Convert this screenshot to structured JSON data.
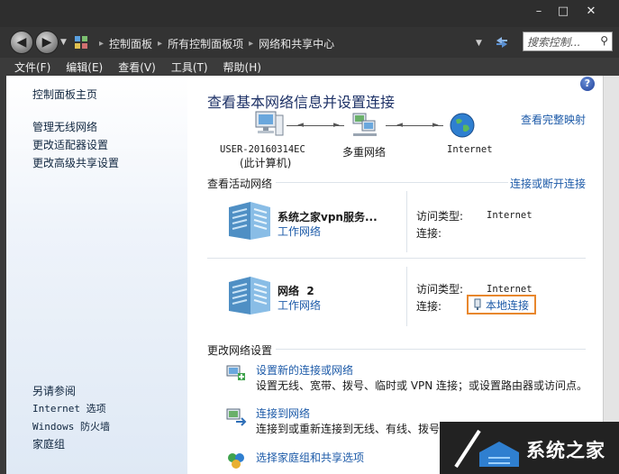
{
  "window": {
    "min_glyph": "–",
    "max_glyph": "□",
    "close_glyph": "✕"
  },
  "nav": {
    "breadcrumbs": [
      "控制面板",
      "所有控制面板项",
      "网络和共享中心"
    ],
    "search_placeholder": "搜索控制...",
    "search_icon_glyph": "⚲"
  },
  "menu": [
    "文件(F)",
    "编辑(E)",
    "查看(V)",
    "工具(T)",
    "帮助(H)"
  ],
  "sidebar": {
    "home": "控制面板主页",
    "links": [
      "管理无线网络",
      "更改适配器设置",
      "更改高级共享设置"
    ],
    "see_also": "另请参阅",
    "see_also_links": [
      "Internet 选项",
      "Windows 防火墙",
      "家庭组"
    ]
  },
  "main": {
    "heading": "查看基本网络信息并设置连接",
    "view_full_map": "查看完整映射",
    "help_glyph": "?",
    "map": {
      "computer_name": "USER-20160314EC",
      "computer_note": "(此计算机)",
      "multi_network": "多重网络",
      "internet": "Internet"
    },
    "active_networks_title": "查看活动网络",
    "connect_disconnect": "连接或断开连接",
    "networks": [
      {
        "name": "系统之家vpn服务...",
        "type": "工作网络",
        "access_label": "访问类型:",
        "access_value": "Internet",
        "connection_label": "连接:",
        "connection_value": ""
      },
      {
        "name": "网络  2",
        "type": "工作网络",
        "access_label": "访问类型:",
        "access_value": "Internet",
        "connection_label": "连接:",
        "connection_value": "本地连接"
      }
    ],
    "change_settings_title": "更改网络设置",
    "tasks": [
      {
        "title": "设置新的连接或网络",
        "desc": "设置无线、宽带、拨号、临时或 VPN 连接；或设置路由器或访问点。"
      },
      {
        "title": "连接到网络",
        "desc": "连接到或重新连接到无线、有线、拨号"
      },
      {
        "title": "选择家庭组和共享选项",
        "desc": ""
      }
    ]
  },
  "watermark": {
    "text": "系统之家"
  },
  "colors": {
    "link": "#1c5aa8",
    "heading": "#1e3267",
    "highlight_border": "#e8872d",
    "chrome": "#333333"
  }
}
